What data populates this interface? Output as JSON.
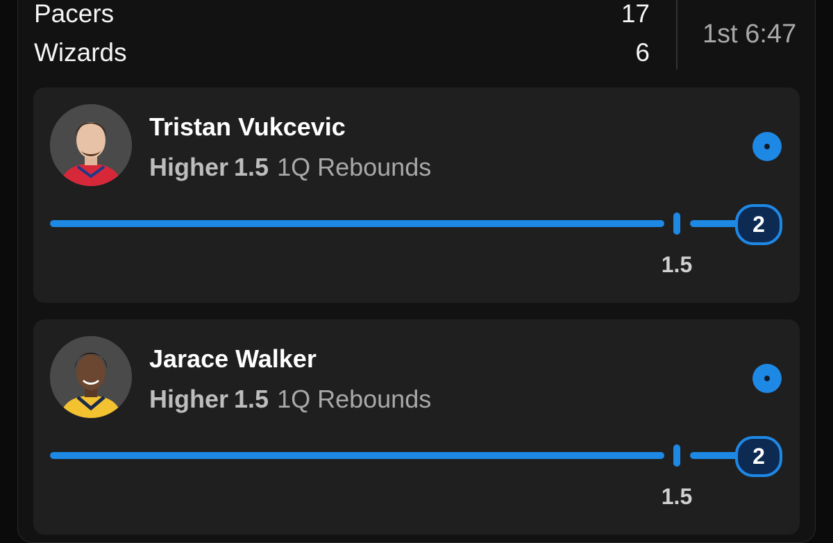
{
  "game": {
    "teams": [
      {
        "name": "Pacers",
        "score": "17"
      },
      {
        "name": "Wizards",
        "score": "6"
      }
    ],
    "clock": "1st 6:47"
  },
  "picks": [
    {
      "player": "Tristan Vukcevic",
      "direction": "Higher",
      "line": "1.5",
      "stat": "1Q Rebounds",
      "current_value": "2",
      "progress_marker_label": "1.5",
      "jersey_color": "#d62839",
      "status_color": "#1e88e5"
    },
    {
      "player": "Jarace Walker",
      "direction": "Higher",
      "line": "1.5",
      "stat": "1Q Rebounds",
      "current_value": "2",
      "progress_marker_label": "1.5",
      "jersey_color": "#f2c230",
      "status_color": "#1e88e5"
    }
  ],
  "colors": {
    "background": "#0b0b0b",
    "card": "#1f1f1f",
    "accent": "#1e88e5"
  }
}
